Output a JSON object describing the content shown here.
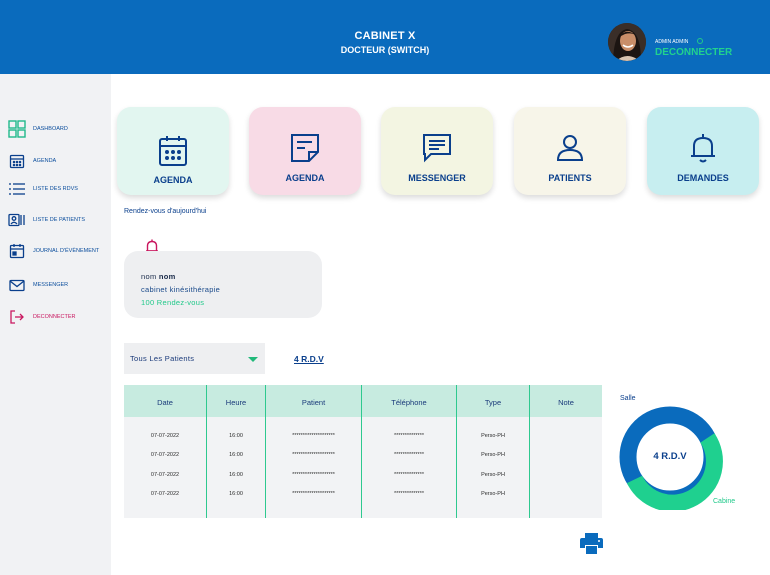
{
  "header": {
    "title": "CABINET X",
    "subtitle": "DOCTEUR (SWITCH)",
    "admin_name": "ADMIN ADMIN",
    "logout": "DECONNECTER"
  },
  "sidebar": {
    "items": [
      {
        "label": "DASHBOARD",
        "icon": "dashboard-icon"
      },
      {
        "label": "AGENDA",
        "icon": "calendar-icon"
      },
      {
        "label": "LISTE DES RDVS",
        "icon": "list-icon"
      },
      {
        "label": "LISTE DE PATIENTS",
        "icon": "patients-list-icon"
      },
      {
        "label": "JOURNAL D'ÉVÈNEMENT",
        "icon": "journal-icon"
      },
      {
        "label": "MESSENGER",
        "icon": "mail-icon"
      },
      {
        "label": "DECONNECTER",
        "icon": "logout-icon"
      }
    ]
  },
  "cards": [
    {
      "label": "AGENDA",
      "icon": "calendar-icon",
      "color": "#e2f6f0"
    },
    {
      "label": "AGENDA",
      "icon": "note-icon",
      "color": "#f8dbe6"
    },
    {
      "label": "MESSENGER",
      "icon": "chat-icon",
      "color": "#f3f5e2"
    },
    {
      "label": "PATIENTS",
      "icon": "user-icon",
      "color": "#f7f5e9"
    },
    {
      "label": "DEMANDES",
      "icon": "bell-icon",
      "color": "#c7eef0"
    }
  ],
  "today": {
    "title": "Rendez-vous d'aujourd'hui",
    "name_prefix": "nom",
    "name_bold": "nom",
    "cabinet": "cabinet kinésithérapie",
    "count": "100 Rendez-vous"
  },
  "filter": {
    "selected": "Tous Les Patients",
    "rdv_count": "4 R.D.V"
  },
  "table": {
    "headers": [
      "Date",
      "Heure",
      "Patient",
      "Téléphone",
      "Type",
      "Note"
    ],
    "rows": [
      [
        "07-07-2022",
        "16:00",
        "********************",
        "**************",
        "Perso-PH",
        ""
      ],
      [
        "07-07-2022",
        "16:00",
        "********************",
        "**************",
        "Perso-PH",
        ""
      ],
      [
        "07-07-2022",
        "16:00",
        "********************",
        "**************",
        "Perso-PH",
        ""
      ],
      [
        "07-07-2022",
        "16:00",
        "********************",
        "**************",
        "Perso-PH",
        ""
      ]
    ]
  },
  "donut": {
    "center": "4 R.D.V",
    "legend_top": "Salle",
    "legend_bottom": "Cabine",
    "colors": {
      "salle": "#0a6bbd",
      "cabine": "#1fd08f"
    }
  },
  "colors": {
    "header": "#0a6bbd",
    "accent": "#21c98a",
    "logout": "#c9175f"
  }
}
